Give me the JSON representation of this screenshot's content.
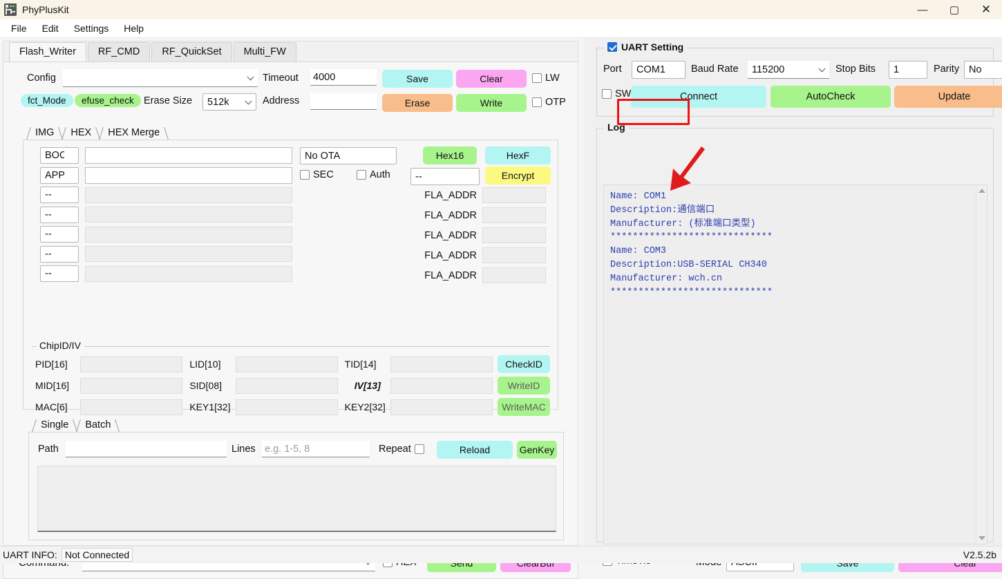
{
  "window": {
    "title": "PhyPlusKit",
    "minimize": "—",
    "maximize": "▢",
    "close": "✕"
  },
  "menu": [
    "File",
    "Edit",
    "Settings",
    "Help"
  ],
  "main_tabs": [
    {
      "label": "Flash_Writer",
      "active": true
    },
    {
      "label": "RF_CMD",
      "active": false
    },
    {
      "label": "RF_QuickSet",
      "active": false
    },
    {
      "label": "Multi_FW",
      "active": false
    }
  ],
  "config_row": {
    "config_label": "Config",
    "config_value": "",
    "timeout_label": "Timeout",
    "timeout_value": "4000",
    "save_label": "Save",
    "clear_label": "Clear",
    "lw_label": "LW",
    "lw_checked": false
  },
  "erase_row": {
    "fct_mode": "fct_Mode",
    "efuse_check": "efuse_check",
    "erase_size_label": "Erase Size",
    "erase_size_value": "512k",
    "address_label": "Address",
    "address_value": "",
    "erase_label": "Erase",
    "write_label": "Write",
    "otp_label": "OTP",
    "otp_checked": false
  },
  "inner_tabs": [
    {
      "label": "IMG",
      "active": false
    },
    {
      "label": "HEX",
      "active": false
    },
    {
      "label": "HEX Merge",
      "active": true
    }
  ],
  "merge_rows": [
    {
      "select": "BOOT",
      "path": "",
      "enabled": true
    },
    {
      "select": "APP",
      "path": "",
      "enabled": true
    },
    {
      "select": "--",
      "path": "",
      "enabled": false
    },
    {
      "select": "--",
      "path": "",
      "enabled": false
    },
    {
      "select": "--",
      "path": "",
      "enabled": false
    },
    {
      "select": "--",
      "path": "",
      "enabled": false
    },
    {
      "select": "--",
      "path": "",
      "enabled": false
    }
  ],
  "merge_right": {
    "ota_value": "No OTA",
    "sec_label": "SEC",
    "sec_checked": false,
    "auth_label": "Auth",
    "auth_checked": false,
    "key_select": "--",
    "hex16_label": "Hex16",
    "hexf_label": "HexF",
    "encrypt_label": "Encrypt",
    "fla_addr_label": "FLA_ADDR",
    "fla_addr_rows": [
      "",
      "",
      "",
      "",
      ""
    ]
  },
  "chipid": {
    "group_title": "ChipID/IV",
    "rows": [
      {
        "c1_label": "PID[16]",
        "c1_value": "",
        "c2_label": "LID[10]",
        "c2_value": "",
        "c3_label": "TID[14]",
        "c3_value": "",
        "button": "CheckID",
        "button_color": "#b2f5f2"
      },
      {
        "c1_label": "MID[16]",
        "c1_value": "",
        "c2_label": "SID[08]",
        "c2_value": "",
        "c3_label": "IV[13]",
        "c3_value": "",
        "button": "WriteID",
        "button_color": "#a8f48c"
      },
      {
        "c1_label": "MAC[6]",
        "c1_value": "",
        "c2_label": "KEY1[32]",
        "c2_value": "",
        "c3_label": "KEY2[32]",
        "c3_value": "",
        "button": "WriteMAC",
        "button_color": "#a8f48c"
      }
    ]
  },
  "batch_tabs": [
    {
      "label": "Single",
      "active": false
    },
    {
      "label": "Batch",
      "active": true
    }
  ],
  "batch": {
    "path_label": "Path",
    "path_value": "",
    "lines_label": "Lines",
    "lines_value": "",
    "lines_placeholder": "e.g. 1-5, 8",
    "repeat_label": "Repeat",
    "repeat_checked": false,
    "reload_label": "Reload",
    "genkey_label": "GenKey",
    "list_content": ""
  },
  "command_bar": {
    "label": "Command:",
    "value": "",
    "hex_label": "HEX",
    "hex_checked": false,
    "send_label": "Send",
    "clearbuf_label": "ClearBuf"
  },
  "uart": {
    "group_title": "UART Setting",
    "group_checked": true,
    "port_label": "Port",
    "port_value": "COM1",
    "baud_label": "Baud Rate",
    "baud_value": "115200",
    "stopbits_label": "Stop Bits",
    "stopbits_value": "1",
    "parity_label": "Parity",
    "parity_value": "No",
    "swd_label": "SWD",
    "swd_checked": false,
    "connect_label": "Connect",
    "autocheck_label": "AutoCheck",
    "update_label": "Update"
  },
  "log": {
    "title": "Log",
    "text": "Name: COM1\nDescription:通信端口\nManufacturer: (标准端口类型)\n*****************************\nName: COM3\nDescription:USB-SERIAL CH340\nManufacturer: wch.cn\n*****************************",
    "timetic_label": "TimeTic",
    "timetic_checked": false,
    "mode_label": "Mode",
    "mode_value": "ASCII",
    "save_label": "Save",
    "clear_label": "Clear"
  },
  "status_bar": {
    "uart_info_label": "UART INFO:",
    "uart_info_value": "Not Connected",
    "version": "V2.5.2b"
  },
  "colors": {
    "cyan": "#b2f5f2",
    "pink": "#fba6f0",
    "orange": "#f8bd8a",
    "green": "#a8f48c",
    "yellow": "#fcf982",
    "highlight_red": "#ee1111",
    "log_text": "#2d3fae"
  }
}
